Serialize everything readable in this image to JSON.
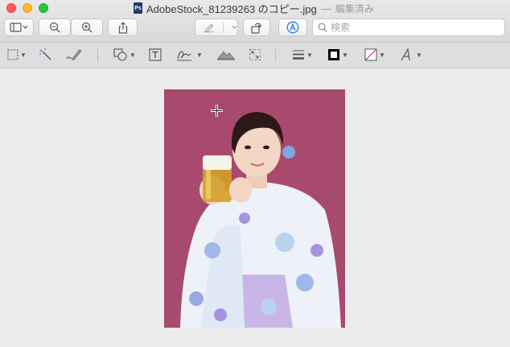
{
  "window": {
    "title": "AdobeStock_81239263 のコピー.jpg",
    "separator": "—",
    "edited_label": "編集済み",
    "doc_icon_text": "Ps"
  },
  "toolbar": {
    "search_placeholder": "検索"
  },
  "colors": {
    "photo_background": "#a84a6e",
    "markup_accent": "#2a7ae2"
  },
  "icons": {
    "sidebar": "sidebar-icon",
    "zoom_out": "zoom-out-icon",
    "zoom_in": "zoom-in-icon",
    "share": "share-icon",
    "pen": "pen-icon",
    "rotate": "rotate-icon",
    "markup": "markup-icon",
    "search": "search-icon"
  }
}
